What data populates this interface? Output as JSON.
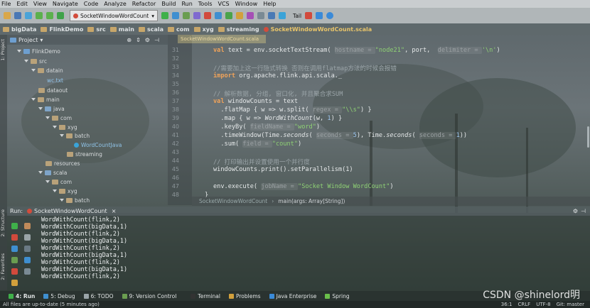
{
  "menu": [
    "File",
    "Edit",
    "View",
    "Navigate",
    "Code",
    "Analyze",
    "Refactor",
    "Build",
    "Run",
    "Tools",
    "VCS",
    "Window",
    "Help"
  ],
  "toolbar": {
    "run_config": "SocketWindowWordCount",
    "tail_label": "Tail"
  },
  "breadcrumbs": [
    "bigData",
    "FlinkDemo",
    "src",
    "main",
    "scala",
    "com",
    "xyg",
    "streaming"
  ],
  "active_file_tab": "SocketWindowWordCount.scala",
  "project_panel": {
    "title": "Project"
  },
  "side_labels": {
    "project": "1: Project",
    "structure": "2: Structure",
    "favorites": "2: Favorites"
  },
  "tree": [
    {
      "label": "FlinkDemo"
    },
    {
      "label": "src"
    },
    {
      "label": "datain"
    },
    {
      "label": "wc.txt"
    },
    {
      "label": "dataout"
    },
    {
      "label": "main"
    },
    {
      "label": "java"
    },
    {
      "label": "com"
    },
    {
      "label": "xyg"
    },
    {
      "label": "batch"
    },
    {
      "label": "WordCountJava"
    },
    {
      "label": "streaming"
    },
    {
      "label": "resources"
    },
    {
      "label": "scala"
    },
    {
      "label": "com"
    },
    {
      "label": "xyg"
    },
    {
      "label": "batch"
    }
  ],
  "line_numbers": [
    "31",
    "32",
    "33",
    "34",
    "35",
    "36",
    "37",
    "38",
    "39",
    "40",
    "41",
    "42",
    "43",
    "44",
    "45",
    "46",
    "47",
    "48"
  ],
  "code": {
    "l31": {
      "kw": "val",
      "a": " text = env.socketTextStream( ",
      "h1": "hostname = ",
      "s1": "\"node21\"",
      "b": ", port,  ",
      "h2": "delimiter = ",
      "s2": "'\\n'",
      "c": ")"
    },
    "l33": "//需要加上这一行隐式转换 否则在调用flatmap方法的时候会报错",
    "l34": {
      "kw": "import",
      "a": " org.apache.flink.api.scala._"
    },
    "l36": "// 解析数据, 分组, 窗口化, 并且聚合求SUM",
    "l37": {
      "kw": "val",
      "a": " windowCounts = text"
    },
    "l38": {
      "a": "  .flatMap { w => w.split( ",
      "h": "regex = ",
      "s": "\"\\\\s\"",
      "b": ") }"
    },
    "l39": {
      "a": "  .map { w => ",
      "it": "WordWithCount",
      "b": "(w, ",
      "n": "1",
      "c": ") }"
    },
    "l40": {
      "a": "  .keyBy( ",
      "h": "fieldName = ",
      "s": "\"word\"",
      "b": ")"
    },
    "l41": {
      "a": "  .timeWindow(Time.",
      "it1": "seconds",
      "b": "( ",
      "h1": "seconds = ",
      "n1": "5",
      "c": "), Time.",
      "it2": "seconds",
      "d": "( ",
      "h2": "seconds = ",
      "n2": "1",
      "e": "))"
    },
    "l42": {
      "a": "  .sum( ",
      "h": "field = ",
      "s": "\"count\"",
      "b": ")"
    },
    "l44": "// 打印输出并设置使用一个并行度",
    "l45": "windowCounts.print().setParallelism(1)",
    "l47": {
      "a": "env.execute( ",
      "h": "jobName = ",
      "s": "\"Socket Window WordCount\"",
      "b": ")"
    },
    "l48": "}"
  },
  "editor_breadcrumb": {
    "object": "SocketWindowWordCount",
    "method": "main(args: Array[String])"
  },
  "run_panel": {
    "label": "Run:",
    "config": "SocketWindowWordCount"
  },
  "console_lines": [
    "WordWithCount(flink,2)",
    "WordWithCount(bigData,1)",
    "WordWithCount(flink,2)",
    "WordWithCount(bigData,1)",
    "WordWithCount(flink,2)",
    "WordWithCount(bigData,1)",
    "WordWithCount(flink,2)",
    "WordWithCount(bigData,1)",
    "WordWithCount(flink,2)"
  ],
  "tool_tabs": [
    "4: Run",
    "5: Debug",
    "6: TODO",
    "9: Version Control",
    "Terminal",
    "Problems",
    "Java Enterprise",
    "Spring"
  ],
  "status": {
    "message": "All files are up-to-date (5 minutes ago)",
    "position": "36:1",
    "line_sep": "CRLF",
    "encoding": "UTF-8",
    "vcs": "Git: master"
  },
  "watermark": "CSDN @shinelord明"
}
